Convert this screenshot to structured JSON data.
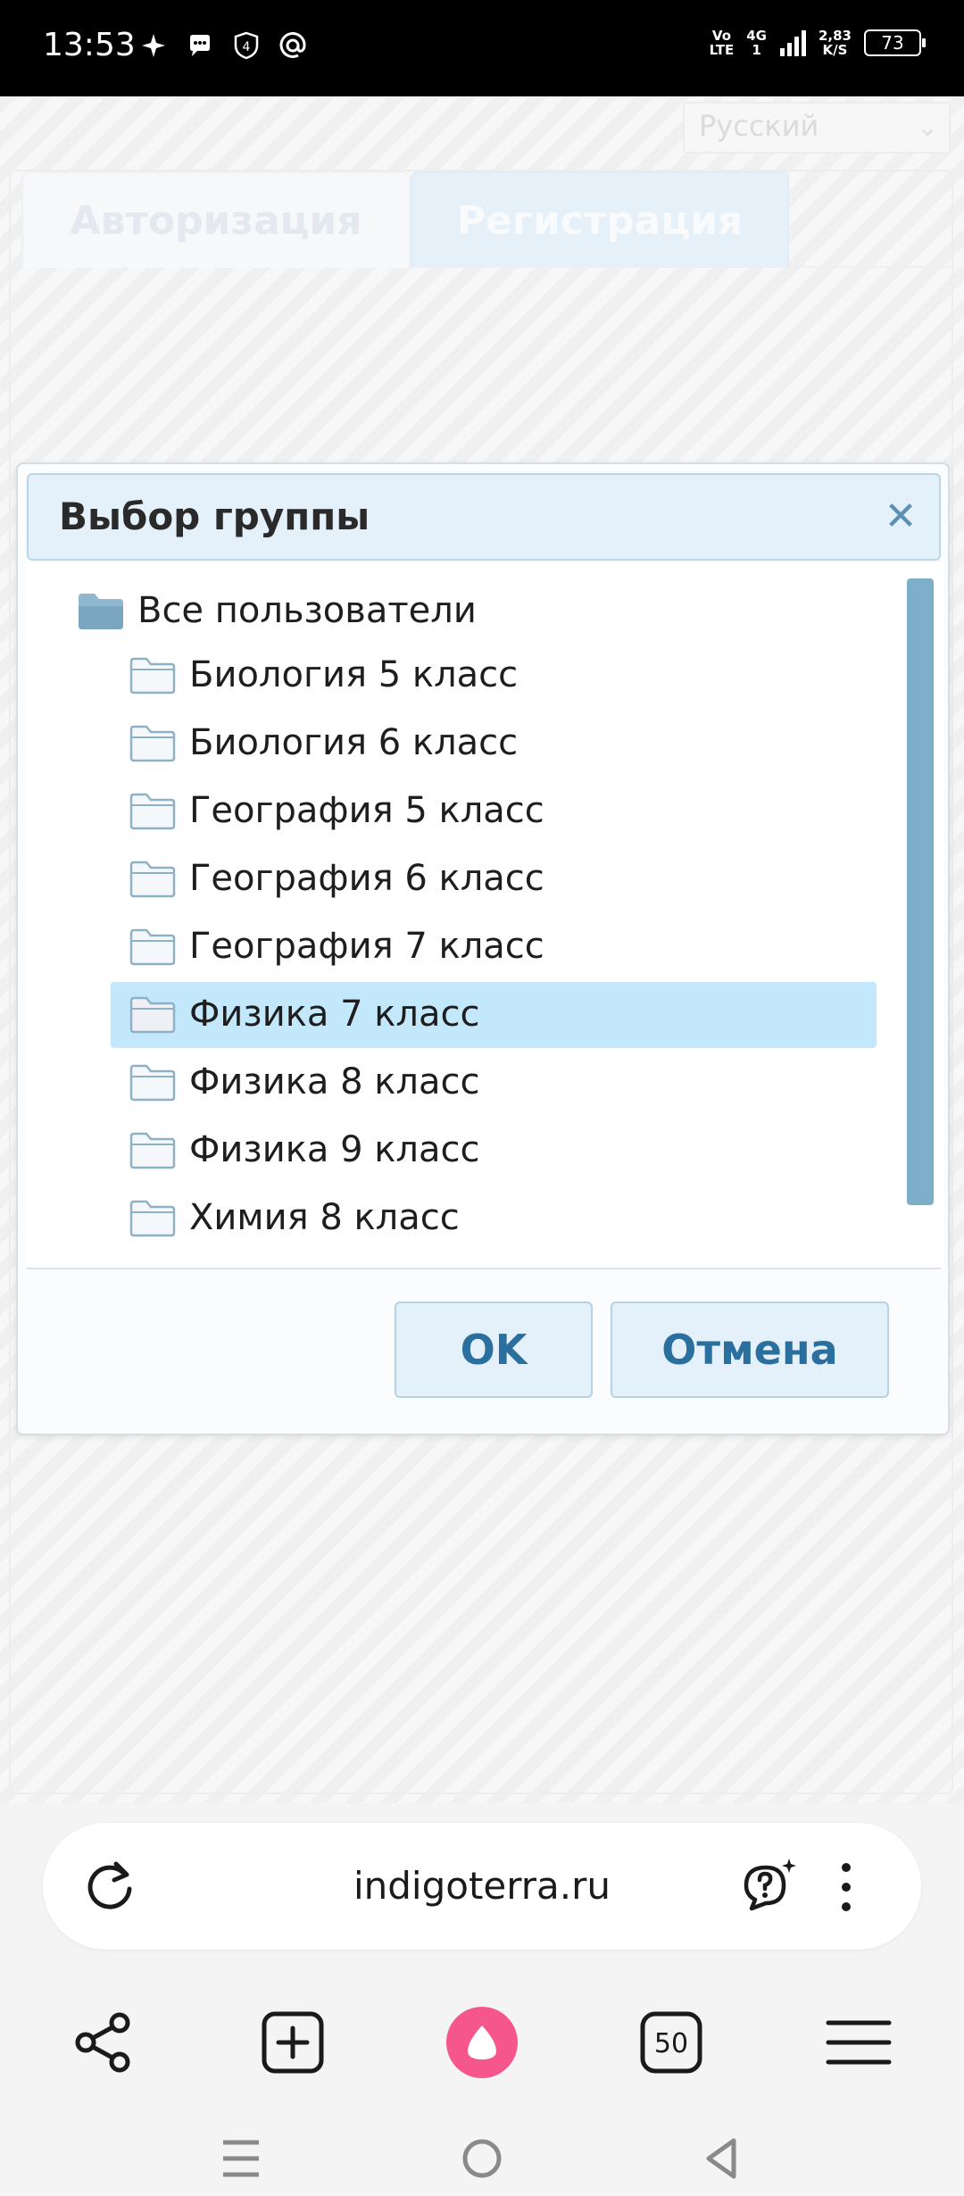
{
  "status_bar": {
    "time": "13:53",
    "left_icons": [
      "sparkle-icon",
      "chat-bubble-icon",
      "shield-badge-icon",
      "at-sign-icon"
    ],
    "shield_badge_text": "4",
    "volte_line1": "Vo",
    "volte_line2": "LTE",
    "network_type": "4G",
    "network_sub": "1",
    "speed_value": "2,83",
    "speed_unit": "K/S",
    "battery": "73"
  },
  "page": {
    "language_select": {
      "value": "Русский"
    },
    "tabs": [
      {
        "label": "Авторизация",
        "active": false
      },
      {
        "label": "Регистрация",
        "active": true
      }
    ]
  },
  "dialog": {
    "title": "Выбор группы",
    "close_icon": "close-icon",
    "tree": {
      "root": "Все пользователи",
      "children": [
        {
          "label": "Биология 5 класс",
          "selected": false
        },
        {
          "label": "Биология 6 класс",
          "selected": false
        },
        {
          "label": "География 5 класс",
          "selected": false
        },
        {
          "label": "География 6 класс",
          "selected": false
        },
        {
          "label": "География 7 класс",
          "selected": false
        },
        {
          "label": "Физика 7 класс",
          "selected": true
        },
        {
          "label": "Физика 8 класс",
          "selected": false
        },
        {
          "label": "Физика 9 класс",
          "selected": false
        },
        {
          "label": "Химия 8 класс",
          "selected": false
        }
      ]
    },
    "buttons": {
      "ok": "OK",
      "cancel": "Отмена"
    }
  },
  "browser": {
    "url": "indigoterra.ru",
    "tabs_count": "50",
    "icons": [
      "reload-icon",
      "alice-chat-icon",
      "more-menu-icon",
      "share-icon",
      "new-tab-icon",
      "alice-icon",
      "tabs-icon",
      "menu-icon"
    ]
  },
  "colors": {
    "accent": "#2b6f9e",
    "selection": "#c3e8fb",
    "header_bg": "#e4f1fa",
    "alice": "#f5578c"
  }
}
